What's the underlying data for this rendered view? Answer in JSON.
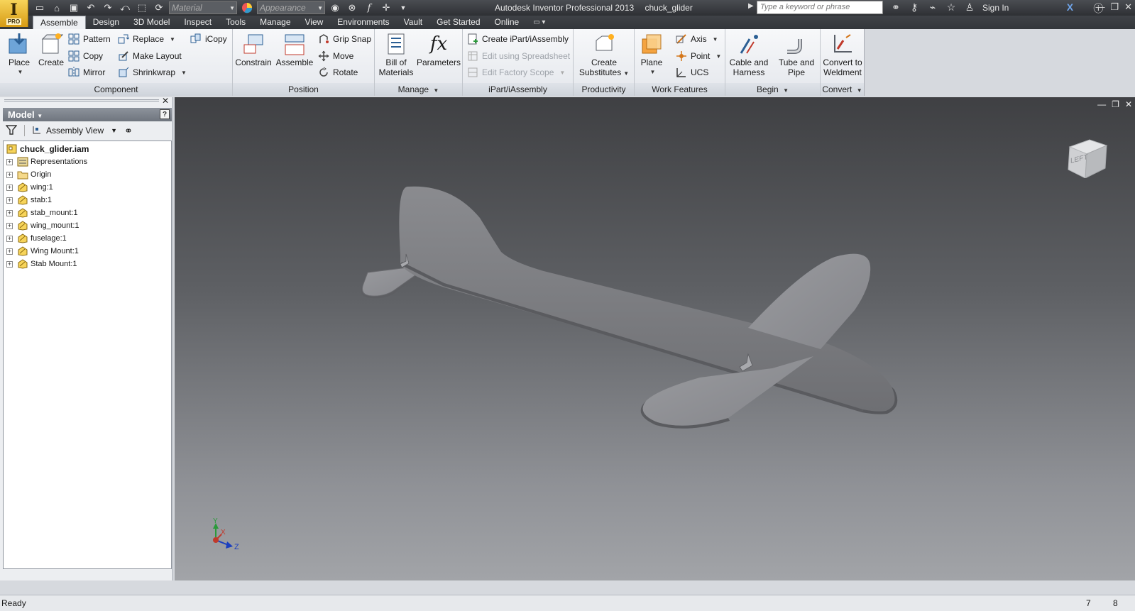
{
  "title_bar": {
    "app_badge": "PRO",
    "material_placeholder": "Material",
    "appearance_placeholder": "Appearance",
    "app_title": "Autodesk Inventor Professional 2013",
    "document": "chuck_glider",
    "search_placeholder": "Type a keyword or phrase",
    "sign_in": "Sign In"
  },
  "tabs": [
    "Assemble",
    "Design",
    "3D Model",
    "Inspect",
    "Tools",
    "Manage",
    "View",
    "Environments",
    "Vault",
    "Get Started",
    "Online"
  ],
  "ribbon": {
    "component": {
      "title": "Component",
      "place": "Place",
      "create": "Create",
      "pattern": "Pattern",
      "copy": "Copy",
      "mirror": "Mirror",
      "replace": "Replace",
      "make_layout": "Make Layout",
      "shrinkwrap": "Shrinkwrap",
      "icopy": "iCopy"
    },
    "position": {
      "title": "Position",
      "constrain": "Constrain",
      "assemble": "Assemble",
      "grip_snap": "Grip Snap",
      "move": "Move",
      "rotate": "Rotate"
    },
    "manage": {
      "title": "Manage",
      "bom_line1": "Bill of",
      "bom_line2": "Materials",
      "parameters": "Parameters"
    },
    "ipart": {
      "title": "iPart/iAssembly",
      "create": "Create iPart/iAssembly",
      "edit_spreadsheet": "Edit using Spreadsheet",
      "edit_factory": "Edit Factory Scope"
    },
    "productivity": {
      "title": "Productivity",
      "line1": "Create",
      "line2": "Substitutes"
    },
    "work_features": {
      "title": "Work Features",
      "plane": "Plane",
      "axis": "Axis",
      "point": "Point",
      "ucs": "UCS"
    },
    "begin": {
      "title": "Begin",
      "cable_line1": "Cable and",
      "cable_line2": "Harness",
      "tube_line1": "Tube and",
      "tube_line2": "Pipe"
    },
    "convert": {
      "title": "Convert",
      "line1": "Convert to",
      "line2": "Weldment"
    }
  },
  "browser": {
    "header": "Model",
    "view_label": "Assembly View",
    "root": "chuck_glider.iam",
    "nodes": [
      {
        "label": "Representations",
        "icon": "representations-icon"
      },
      {
        "label": "Origin",
        "icon": "folder-icon"
      },
      {
        "label": "wing:1",
        "icon": "part-icon"
      },
      {
        "label": "stab:1",
        "icon": "part-icon"
      },
      {
        "label": "stab_mount:1",
        "icon": "part-icon"
      },
      {
        "label": "wing_mount:1",
        "icon": "part-icon"
      },
      {
        "label": "fuselage:1",
        "icon": "part-icon"
      },
      {
        "label": "Wing Mount:1",
        "icon": "part-icon"
      },
      {
        "label": "Stab Mount:1",
        "icon": "part-icon"
      }
    ]
  },
  "viewport": {
    "viewcube_face": "LEFT",
    "triad_x": "X",
    "triad_y": "Y",
    "triad_z": "Z"
  },
  "status": {
    "text": "Ready",
    "n1": "7",
    "n2": "8"
  },
  "colors": {
    "title_bar": "#3a3d41",
    "ribbon": "#eef0f3",
    "viewport_top": "#3f4043",
    "viewport_bottom": "#a2a4a8",
    "model_gray": "#8c8d91"
  }
}
